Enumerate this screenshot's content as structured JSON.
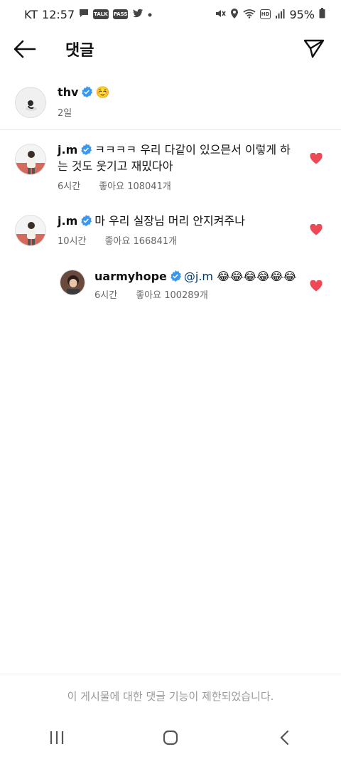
{
  "status_bar": {
    "carrier": "KT",
    "time": "12:57",
    "talk_badge": "TALK",
    "pass_badge": "PASS",
    "hd_badge": "HD",
    "battery": "95%"
  },
  "header": {
    "title": "댓글"
  },
  "caption": {
    "username": "thv",
    "text": "☺️",
    "time": "2일"
  },
  "comments": [
    {
      "username": "j.m",
      "text": "ㅋㅋㅋㅋ 우리 다같이 있으믄서 이렇게 하는 것도 웃기고 재밌다아",
      "time": "6시간",
      "likes": "좋아요 108041개"
    },
    {
      "username": "j.m",
      "text": "마 우리 실장님 머리 안지켜주나",
      "time": "10시간",
      "likes": "좋아요 166841개"
    },
    {
      "username": "uarmyhope",
      "mention": "@j.m",
      "text": "😂😂😂😂😂😂",
      "time": "6시간",
      "likes": "좋아요 100289개"
    }
  ],
  "footer": {
    "notice": "이 게시물에 대한 댓글 기능이 제한되었습니다."
  },
  "colors": {
    "verified": "#3897f0",
    "heart": "#ed4956",
    "mention": "#00376b"
  }
}
